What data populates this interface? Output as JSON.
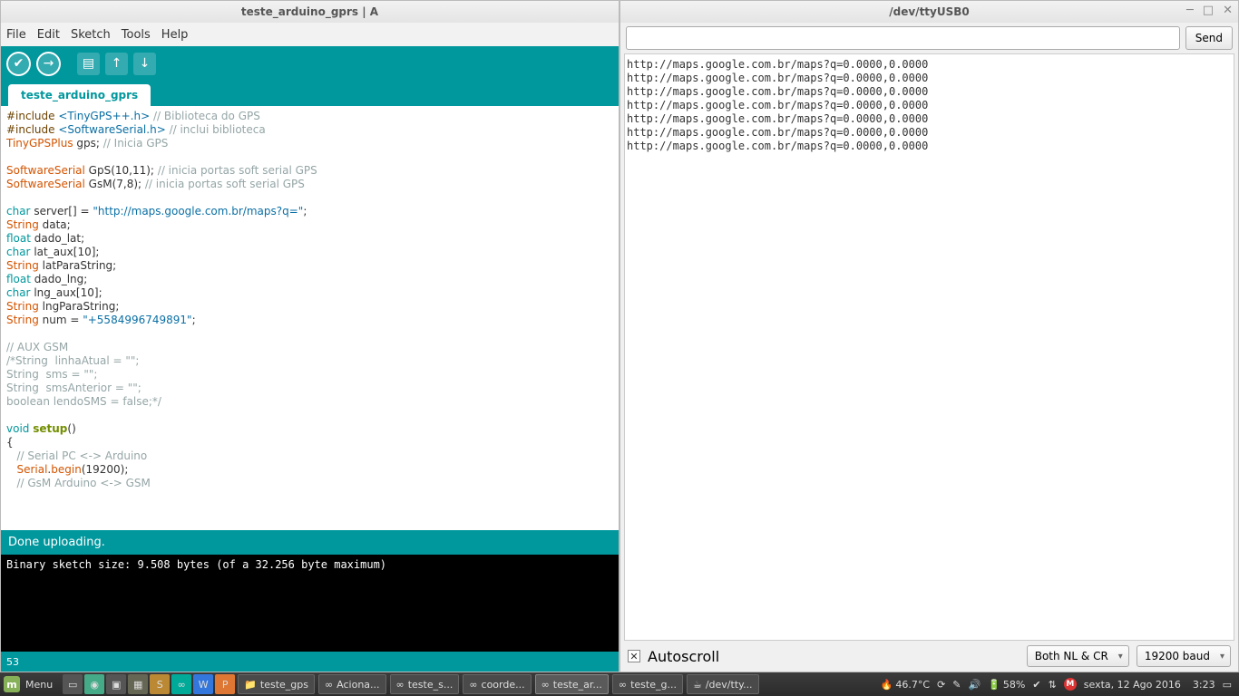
{
  "ide": {
    "title": "teste_arduino_gprs | A",
    "menu": [
      "File",
      "Edit",
      "Sketch",
      "Tools",
      "Help"
    ],
    "tab": "teste_arduino_gprs",
    "status": "Done uploading.",
    "console": "Binary sketch size: 9.508 bytes (of a 32.256 byte maximum)",
    "footer": "53",
    "code_lines": [
      {
        "t": [
          {
            "s": "pr",
            "v": "#include "
          },
          {
            "s": "st",
            "v": "<TinyGPS++.h>"
          },
          {
            "s": "cm",
            "v": " // Biblioteca do GPS"
          }
        ]
      },
      {
        "t": [
          {
            "s": "pr",
            "v": "#include "
          },
          {
            "s": "st",
            "v": "<SoftwareSerial.h>"
          },
          {
            "s": "cm",
            "v": " // inclui biblioteca"
          }
        ]
      },
      {
        "t": [
          {
            "s": "kw",
            "v": "TinyGPSPlus"
          },
          {
            "s": "",
            "v": " gps; "
          },
          {
            "s": "cm",
            "v": "// Inicia GPS"
          }
        ]
      },
      {
        "t": [
          {
            "s": "",
            "v": ""
          }
        ]
      },
      {
        "t": [
          {
            "s": "kw",
            "v": "SoftwareSerial"
          },
          {
            "s": "",
            "v": " GpS(10,11); "
          },
          {
            "s": "cm",
            "v": "// inicia portas soft serial GPS"
          }
        ]
      },
      {
        "t": [
          {
            "s": "kw",
            "v": "SoftwareSerial"
          },
          {
            "s": "",
            "v": " GsM(7,8); "
          },
          {
            "s": "cm",
            "v": "// inicia portas soft serial GPS"
          }
        ]
      },
      {
        "t": [
          {
            "s": "",
            "v": ""
          }
        ]
      },
      {
        "t": [
          {
            "s": "ty",
            "v": "char"
          },
          {
            "s": "",
            "v": " server[] = "
          },
          {
            "s": "st",
            "v": "\"http://maps.google.com.br/maps?q=\""
          },
          {
            "s": "",
            "v": ";"
          }
        ]
      },
      {
        "t": [
          {
            "s": "kw",
            "v": "String"
          },
          {
            "s": "",
            "v": " data;"
          }
        ]
      },
      {
        "t": [
          {
            "s": "ty",
            "v": "float"
          },
          {
            "s": "",
            "v": " dado_lat;"
          }
        ]
      },
      {
        "t": [
          {
            "s": "ty",
            "v": "char"
          },
          {
            "s": "",
            "v": " lat_aux[10];"
          }
        ]
      },
      {
        "t": [
          {
            "s": "kw",
            "v": "String"
          },
          {
            "s": "",
            "v": " latParaString;"
          }
        ]
      },
      {
        "t": [
          {
            "s": "ty",
            "v": "float"
          },
          {
            "s": "",
            "v": " dado_lng;"
          }
        ]
      },
      {
        "t": [
          {
            "s": "ty",
            "v": "char"
          },
          {
            "s": "",
            "v": " lng_aux[10];"
          }
        ]
      },
      {
        "t": [
          {
            "s": "kw",
            "v": "String"
          },
          {
            "s": "",
            "v": " lngParaString;"
          }
        ]
      },
      {
        "t": [
          {
            "s": "kw",
            "v": "String"
          },
          {
            "s": "",
            "v": " num = "
          },
          {
            "s": "st",
            "v": "\"+5584996749891\""
          },
          {
            "s": "",
            "v": ";"
          }
        ]
      },
      {
        "t": [
          {
            "s": "",
            "v": ""
          }
        ]
      },
      {
        "t": [
          {
            "s": "cm",
            "v": "// AUX GSM"
          }
        ]
      },
      {
        "t": [
          {
            "s": "cm",
            "v": "/*String  linhaAtual = \"\";"
          }
        ]
      },
      {
        "t": [
          {
            "s": "cm",
            "v": "String  sms = \"\";"
          }
        ]
      },
      {
        "t": [
          {
            "s": "cm",
            "v": "String  smsAnterior = \"\";"
          }
        ]
      },
      {
        "t": [
          {
            "s": "cm",
            "v": "boolean lendoSMS = false;*/"
          }
        ]
      },
      {
        "t": [
          {
            "s": "",
            "v": ""
          }
        ]
      },
      {
        "t": [
          {
            "s": "ty",
            "v": "void"
          },
          {
            "s": "",
            "v": " "
          },
          {
            "s": "fn",
            "v": "setup"
          },
          {
            "s": "",
            "v": "()"
          }
        ]
      },
      {
        "t": [
          {
            "s": "",
            "v": "{"
          }
        ]
      },
      {
        "t": [
          {
            "s": "",
            "v": "   "
          },
          {
            "s": "cm",
            "v": "// Serial PC <-> Arduino"
          }
        ]
      },
      {
        "t": [
          {
            "s": "",
            "v": "   "
          },
          {
            "s": "kw",
            "v": "Serial"
          },
          {
            "s": "",
            "v": "."
          },
          {
            "s": "kw",
            "v": "begin"
          },
          {
            "s": "",
            "v": "(19200);"
          }
        ]
      },
      {
        "t": [
          {
            "s": "",
            "v": "   "
          },
          {
            "s": "cm",
            "v": "// GsM Arduino <-> GSM"
          }
        ]
      }
    ]
  },
  "serial": {
    "title": "/dev/ttyUSB0",
    "send": "Send",
    "input_value": "",
    "output": [
      "http://maps.google.com.br/maps?q=0.0000,0.0000",
      "http://maps.google.com.br/maps?q=0.0000,0.0000",
      "http://maps.google.com.br/maps?q=0.0000,0.0000",
      "http://maps.google.com.br/maps?q=0.0000,0.0000",
      "http://maps.google.com.br/maps?q=0.0000,0.0000",
      "http://maps.google.com.br/maps?q=0.0000,0.0000",
      "http://maps.google.com.br/maps?q=0.0000,0.0000"
    ],
    "autoscroll": "Autoscroll",
    "line_ending": "Both NL & CR",
    "baud": "19200 baud"
  },
  "taskbar": {
    "menu": "Menu",
    "tasks": [
      {
        "icon": "📁",
        "label": "teste_gps"
      },
      {
        "icon": "∞",
        "label": "Aciona..."
      },
      {
        "icon": "∞",
        "label": "teste_s..."
      },
      {
        "icon": "∞",
        "label": "coorde..."
      },
      {
        "icon": "∞",
        "label": "teste_ar..."
      },
      {
        "icon": "∞",
        "label": "teste_g..."
      },
      {
        "icon": "☕",
        "label": "/dev/tty..."
      }
    ],
    "temp": "46.7°C",
    "battery": "58%",
    "date": "sexta, 12 Ago 2016",
    "time": "3:23"
  }
}
